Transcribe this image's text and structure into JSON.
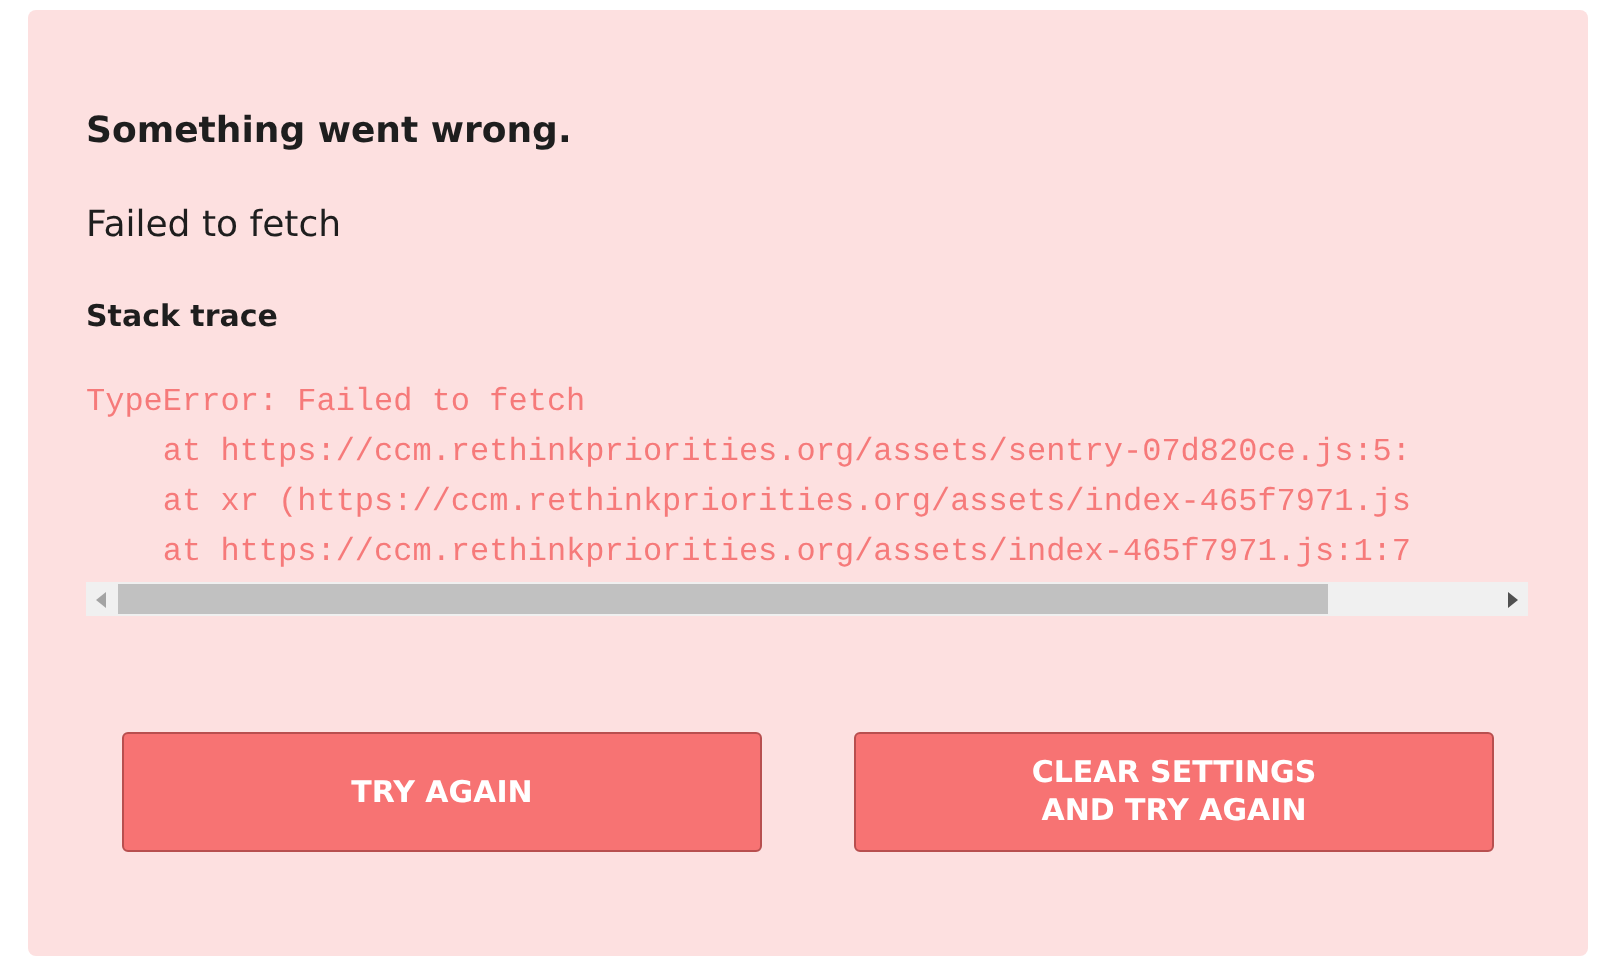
{
  "error": {
    "title": "Something went wrong.",
    "message": "Failed to fetch"
  },
  "stack_trace": {
    "heading": "Stack trace",
    "lines": [
      "TypeError: Failed to fetch",
      "    at https://ccm.rethinkpriorities.org/assets/sentry-07d820ce.js:5:",
      "    at xr (https://ccm.rethinkpriorities.org/assets/index-465f7971.js",
      "    at https://ccm.rethinkpriorities.org/assets/index-465f7971.js:1:7"
    ]
  },
  "buttons": [
    {
      "lines": [
        "TRY AGAIN"
      ]
    },
    {
      "lines": [
        "CLEAR SETTINGS",
        "AND TRY AGAIN"
      ]
    }
  ]
}
